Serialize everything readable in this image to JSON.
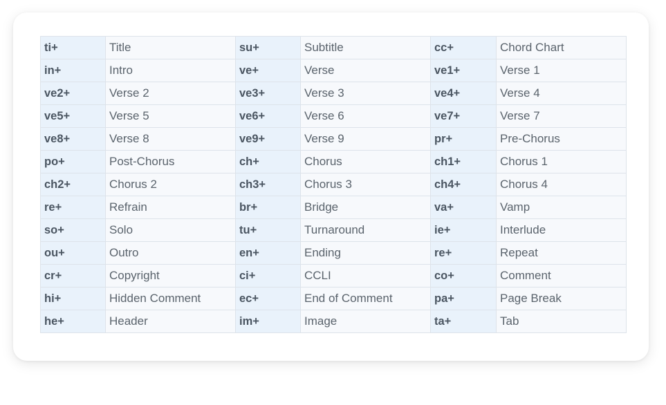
{
  "codes_table": {
    "rows": [
      [
        {
          "code": "ti+",
          "label": "Title"
        },
        {
          "code": "su+",
          "label": "Subtitle"
        },
        {
          "code": "cc+",
          "label": "Chord Chart"
        }
      ],
      [
        {
          "code": "in+",
          "label": "Intro"
        },
        {
          "code": "ve+",
          "label": "Verse"
        },
        {
          "code": "ve1+",
          "label": "Verse 1"
        }
      ],
      [
        {
          "code": "ve2+",
          "label": "Verse 2"
        },
        {
          "code": "ve3+",
          "label": "Verse 3"
        },
        {
          "code": "ve4+",
          "label": "Verse 4"
        }
      ],
      [
        {
          "code": "ve5+",
          "label": "Verse 5"
        },
        {
          "code": "ve6+",
          "label": "Verse 6"
        },
        {
          "code": "ve7+",
          "label": "Verse 7"
        }
      ],
      [
        {
          "code": "ve8+",
          "label": "Verse 8"
        },
        {
          "code": "ve9+",
          "label": "Verse 9"
        },
        {
          "code": "pr+",
          "label": "Pre-Chorus"
        }
      ],
      [
        {
          "code": "po+",
          "label": "Post-Chorus"
        },
        {
          "code": "ch+",
          "label": "Chorus"
        },
        {
          "code": "ch1+",
          "label": "Chorus 1"
        }
      ],
      [
        {
          "code": "ch2+",
          "label": "Chorus 2"
        },
        {
          "code": "ch3+",
          "label": "Chorus 3"
        },
        {
          "code": "ch4+",
          "label": "Chorus 4"
        }
      ],
      [
        {
          "code": "re+",
          "label": "Refrain"
        },
        {
          "code": "br+",
          "label": "Bridge"
        },
        {
          "code": "va+",
          "label": "Vamp"
        }
      ],
      [
        {
          "code": "so+",
          "label": "Solo"
        },
        {
          "code": "tu+",
          "label": "Turnaround"
        },
        {
          "code": "ie+",
          "label": "Interlude"
        }
      ],
      [
        {
          "code": "ou+",
          "label": "Outro"
        },
        {
          "code": "en+",
          "label": "Ending"
        },
        {
          "code": "re+",
          "label": "Repeat"
        }
      ],
      [
        {
          "code": "cr+",
          "label": "Copyright"
        },
        {
          "code": "ci+",
          "label": "CCLI"
        },
        {
          "code": "co+",
          "label": "Comment"
        }
      ],
      [
        {
          "code": "hi+",
          "label": "Hidden Comment"
        },
        {
          "code": "ec+",
          "label": "End of Comment"
        },
        {
          "code": "pa+",
          "label": "Page Break"
        }
      ],
      [
        {
          "code": "he+",
          "label": "Header"
        },
        {
          "code": "im+",
          "label": "Image"
        },
        {
          "code": "ta+",
          "label": "Tab"
        }
      ]
    ]
  },
  "colors": {
    "code_cell_bg": "#e9f2fb",
    "label_cell_bg": "#f7f9fc",
    "border": "#dde3ea",
    "code_text": "#4a5561",
    "label_text": "#5a636c"
  }
}
